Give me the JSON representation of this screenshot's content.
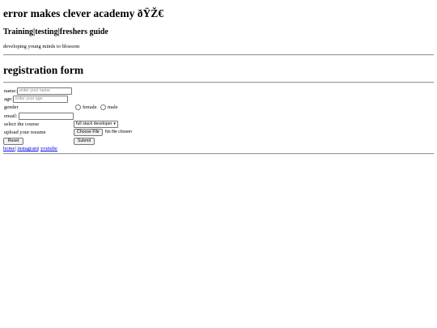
{
  "header": {
    "title": "error makes clever academy ðŸŽ€",
    "subtitle": "Training|testing|freshers guide",
    "tagline": "developing young minds to blossom"
  },
  "form": {
    "heading": "registration form",
    "name_label": "name:",
    "name_placeholder": "enter your name",
    "age_label": "age:",
    "age_placeholder": "enter your age",
    "gender_label": "gender",
    "gender_options": [
      "female",
      "male"
    ],
    "email_label": "email:",
    "email_value": "",
    "course_label": "select the course",
    "course_selected": "full stack developer",
    "resume_label": "upload your resume",
    "choose_file_label": "Choose File",
    "file_status": "No file chosen",
    "reset_label": "Reset",
    "submit_label": "Submit"
  },
  "footer": {
    "links": [
      "home",
      "instagram",
      "youtube"
    ],
    "separator": "|"
  }
}
